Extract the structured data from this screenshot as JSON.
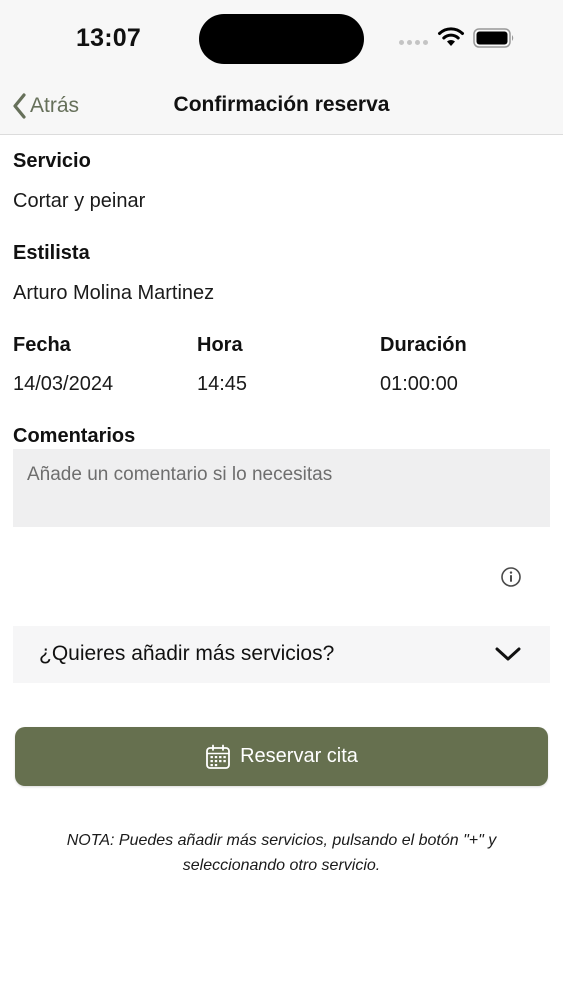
{
  "status_bar": {
    "time": "13:07"
  },
  "nav": {
    "back_label": "Atrás",
    "title": "Confirmación reserva"
  },
  "booking": {
    "service_label": "Servicio",
    "service_value": "Cortar y peinar",
    "stylist_label": "Estilista",
    "stylist_value": "Arturo Molina Martinez",
    "date_label": "Fecha",
    "date_value": "14/03/2024",
    "time_label": "Hora",
    "time_value": "14:45",
    "duration_label": "Duración",
    "duration_value": "01:00:00",
    "comments_label": "Comentarios",
    "comments_placeholder": "Añade un comentario si lo necesitas",
    "comments_value": ""
  },
  "more_services": {
    "label": "¿Quieres añadir más servicios?"
  },
  "book_button": {
    "label": "Reservar cita"
  },
  "note": "NOTA: Puedes añadir más servicios, pulsando el botón \"+\" y seleccionando otro servicio.",
  "icons": {
    "back": "chevron-left-icon",
    "info": "info-icon",
    "dropdown": "chevron-down-icon",
    "calendar": "calendar-icon",
    "wifi": "wifi-icon",
    "battery": "battery-icon",
    "signal": "signal-icon"
  },
  "colors": {
    "accent": "#66704f",
    "back_text": "#66705a",
    "bar_background": "#f7f7f7",
    "input_background": "#efeff0"
  }
}
